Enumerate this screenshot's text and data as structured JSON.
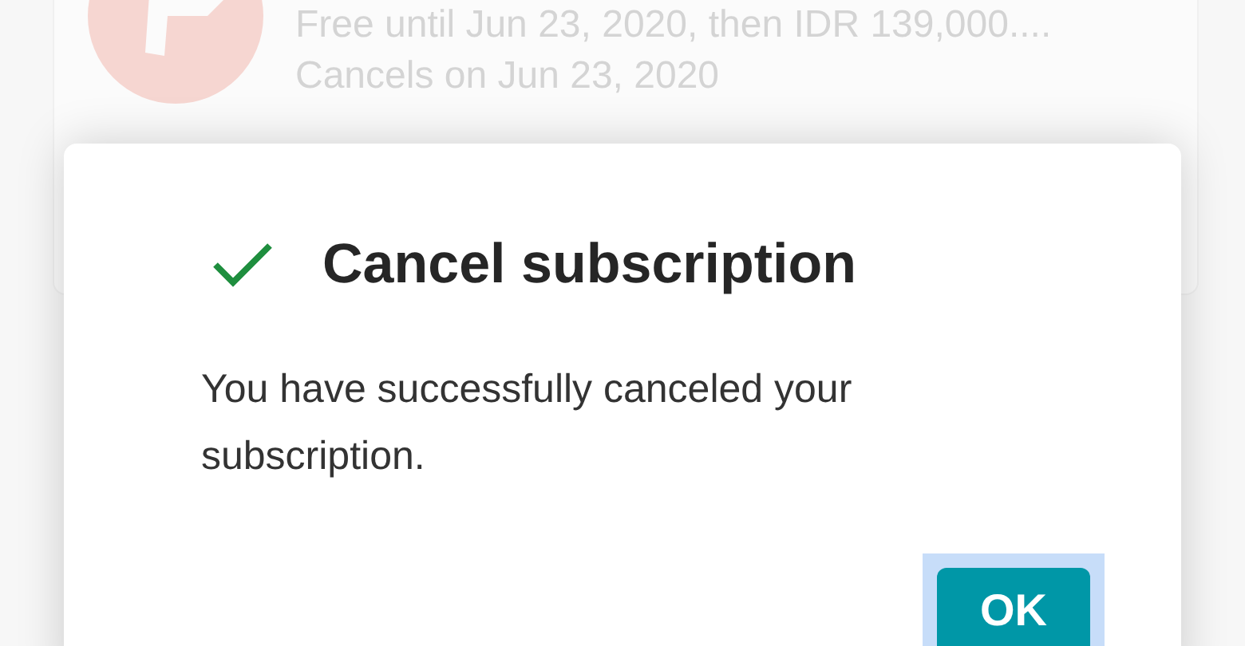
{
  "background_card": {
    "price_line": "Free until Jun 23, 2020, then IDR 139,000....",
    "cancel_line": "Cancels on Jun 23, 2020"
  },
  "dialog": {
    "title": "Cancel subscription",
    "message": "You have successfully canceled your subscription.",
    "buttons": [
      {
        "label": "OK",
        "focused": true
      }
    ]
  }
}
